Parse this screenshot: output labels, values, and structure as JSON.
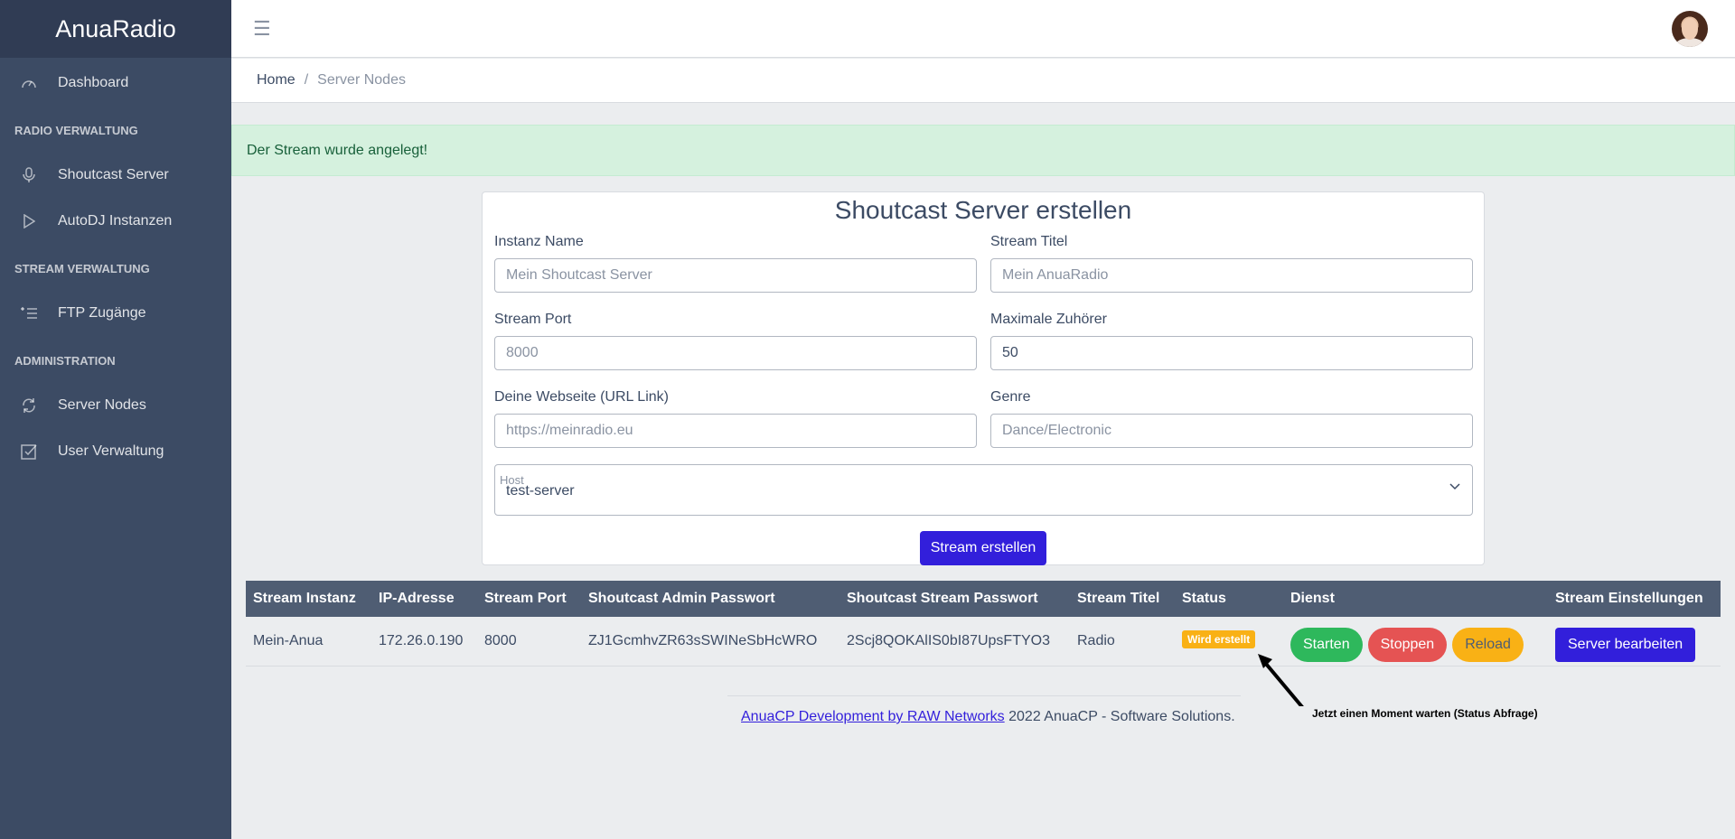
{
  "app": {
    "brand": "AnuaRadio"
  },
  "sidebar": {
    "dashboard": {
      "label": "Dashboard",
      "icon": "speedometer-icon"
    },
    "section_radio": "RADIO VERWALTUNG",
    "shoutcast": {
      "label": "Shoutcast Server",
      "icon": "microphone-icon"
    },
    "autodj": {
      "label": "AutoDJ Instanzen",
      "icon": "play-icon"
    },
    "section_stream": "STREAM VERWALTUNG",
    "ftp": {
      "label": "FTP Zugänge",
      "icon": "list-icon"
    },
    "section_admin": "ADMINISTRATION",
    "server_nodes": {
      "label": "Server Nodes",
      "icon": "sync-icon"
    },
    "users": {
      "label": "User Verwaltung",
      "icon": "check-square-icon"
    }
  },
  "breadcrumb": {
    "home": "Home",
    "separator": "/",
    "current": "Server Nodes"
  },
  "alert": {
    "message": "Der Stream wurde angelegt!"
  },
  "form": {
    "title": "Shoutcast Server erstellen",
    "instance_name": {
      "label": "Instanz Name",
      "placeholder": "Mein Shoutcast Server",
      "value": ""
    },
    "stream_title": {
      "label": "Stream Titel",
      "placeholder": "Mein AnuaRadio",
      "value": ""
    },
    "stream_port": {
      "label": "Stream Port",
      "placeholder": "8000",
      "value": ""
    },
    "max_listeners": {
      "label": "Maximale Zuhörer",
      "placeholder": "",
      "value": "50"
    },
    "website": {
      "label": "Deine Webseite (URL Link)",
      "placeholder": "https://meinradio.eu",
      "value": ""
    },
    "genre": {
      "label": "Genre",
      "placeholder": "Dance/Electronic",
      "value": ""
    },
    "host": {
      "label": "Host",
      "value": "test-server"
    },
    "submit": "Stream erstellen"
  },
  "table": {
    "headers": [
      "Stream Instanz",
      "IP-Adresse",
      "Stream Port",
      "Shoutcast Admin Passwort",
      "Shoutcast Stream Passwort",
      "Stream Titel",
      "Status",
      "Dienst",
      "Stream Einstellungen"
    ],
    "rows": [
      {
        "instance": "Mein-Anua",
        "ip": "172.26.0.190",
        "port": "8000",
        "admin_pw": "ZJ1GcmhvZR63sSWINeSbHcWRO",
        "stream_pw": "2Scj8QOKAlIS0bI87UpsFTYO3",
        "title": "Radio",
        "status": "Wird erstellt",
        "start": "Starten",
        "stop": "Stoppen",
        "reload": "Reload",
        "edit": "Server bearbeiten"
      }
    ]
  },
  "footer": {
    "link": "AnuaCP Development by RAW Networks",
    "text": " 2022 AnuaCP - Software Solutions."
  },
  "annotation": {
    "text": "Jetzt einen Moment warten (Status Abfrage)"
  }
}
